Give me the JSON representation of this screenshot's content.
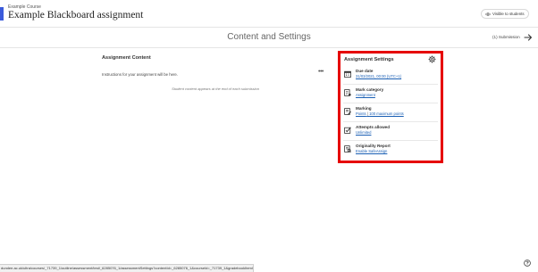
{
  "header": {
    "course": "Example Course",
    "title": "Example Blackboard assignment",
    "visibility": "Visible to students"
  },
  "subheader": {
    "title": "Content and Settings",
    "submissions": "(1) Submission"
  },
  "content": {
    "heading": "Assignment Content",
    "instructions": "Instructions for your assignment will be here.",
    "more": "•••",
    "student_note": "Student content appears at the end of each submission"
  },
  "settings": {
    "heading": "Assignment Settings",
    "rows": [
      {
        "label": "Due date",
        "value": "31/03/2021, 00:00 (UTC+1)",
        "icon": "calendar-icon"
      },
      {
        "label": "Mark category",
        "value": "Assignment",
        "icon": "category-icon"
      },
      {
        "label": "Marking",
        "value1": "Points",
        "sep": "|",
        "value2": "100 maximum points",
        "icon": "marking-icon"
      },
      {
        "label": "Attempts allowed",
        "value": "Unlimited",
        "icon": "attempts-icon"
      },
      {
        "label": "Originality Report",
        "value": "Enable SafeAssign",
        "icon": "originality-icon"
      }
    ]
  },
  "statusbar": {
    "url": "dundee.ac.uk/ultra/courses/_71739_1/outline/assessment/test/_6285076_1/assessmentSettings?contentId=_6285076_1&courseId=_71739_1&gradebookItemId=details"
  },
  "colors": {
    "accent": "#3b5bdb",
    "highlight": "#e60000",
    "link": "#1a5fb4"
  }
}
